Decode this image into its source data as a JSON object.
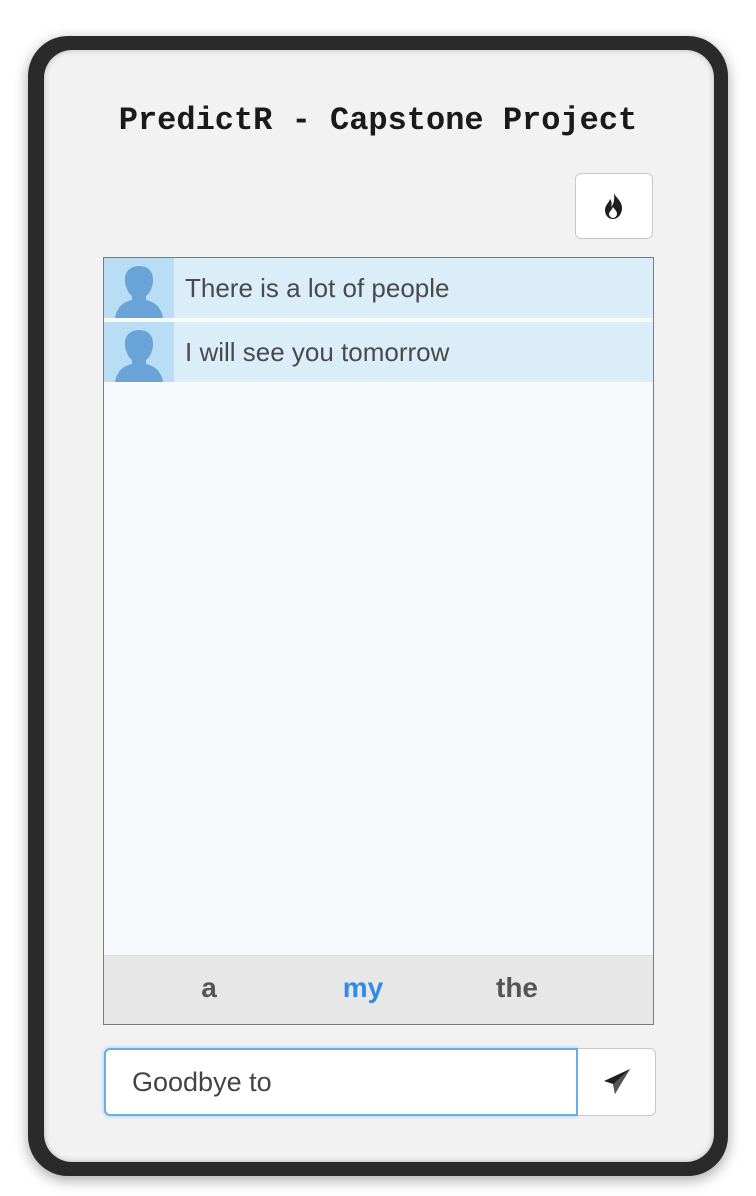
{
  "app": {
    "title": "PredictR - Capstone Project"
  },
  "toolbar": {
    "clear_icon": "fire-icon"
  },
  "chat": {
    "messages": [
      {
        "text": "There is a lot of people",
        "avatar_icon": "user-silhouette-icon"
      },
      {
        "text": "I will see you tomorrow",
        "avatar_icon": "user-silhouette-icon"
      }
    ]
  },
  "suggestions": {
    "words": [
      "a",
      "my",
      "the"
    ],
    "highlighted": "my"
  },
  "composer": {
    "input_value": "Goodbye to",
    "send_icon": "paper-plane-icon"
  },
  "colors": {
    "message_background": "#dbedf9",
    "avatar_background": "#b9ddf5",
    "avatar_figure": "#6aa3d8",
    "highlight_word": "#2e8ce6",
    "input_focus_border": "#66aee8"
  }
}
